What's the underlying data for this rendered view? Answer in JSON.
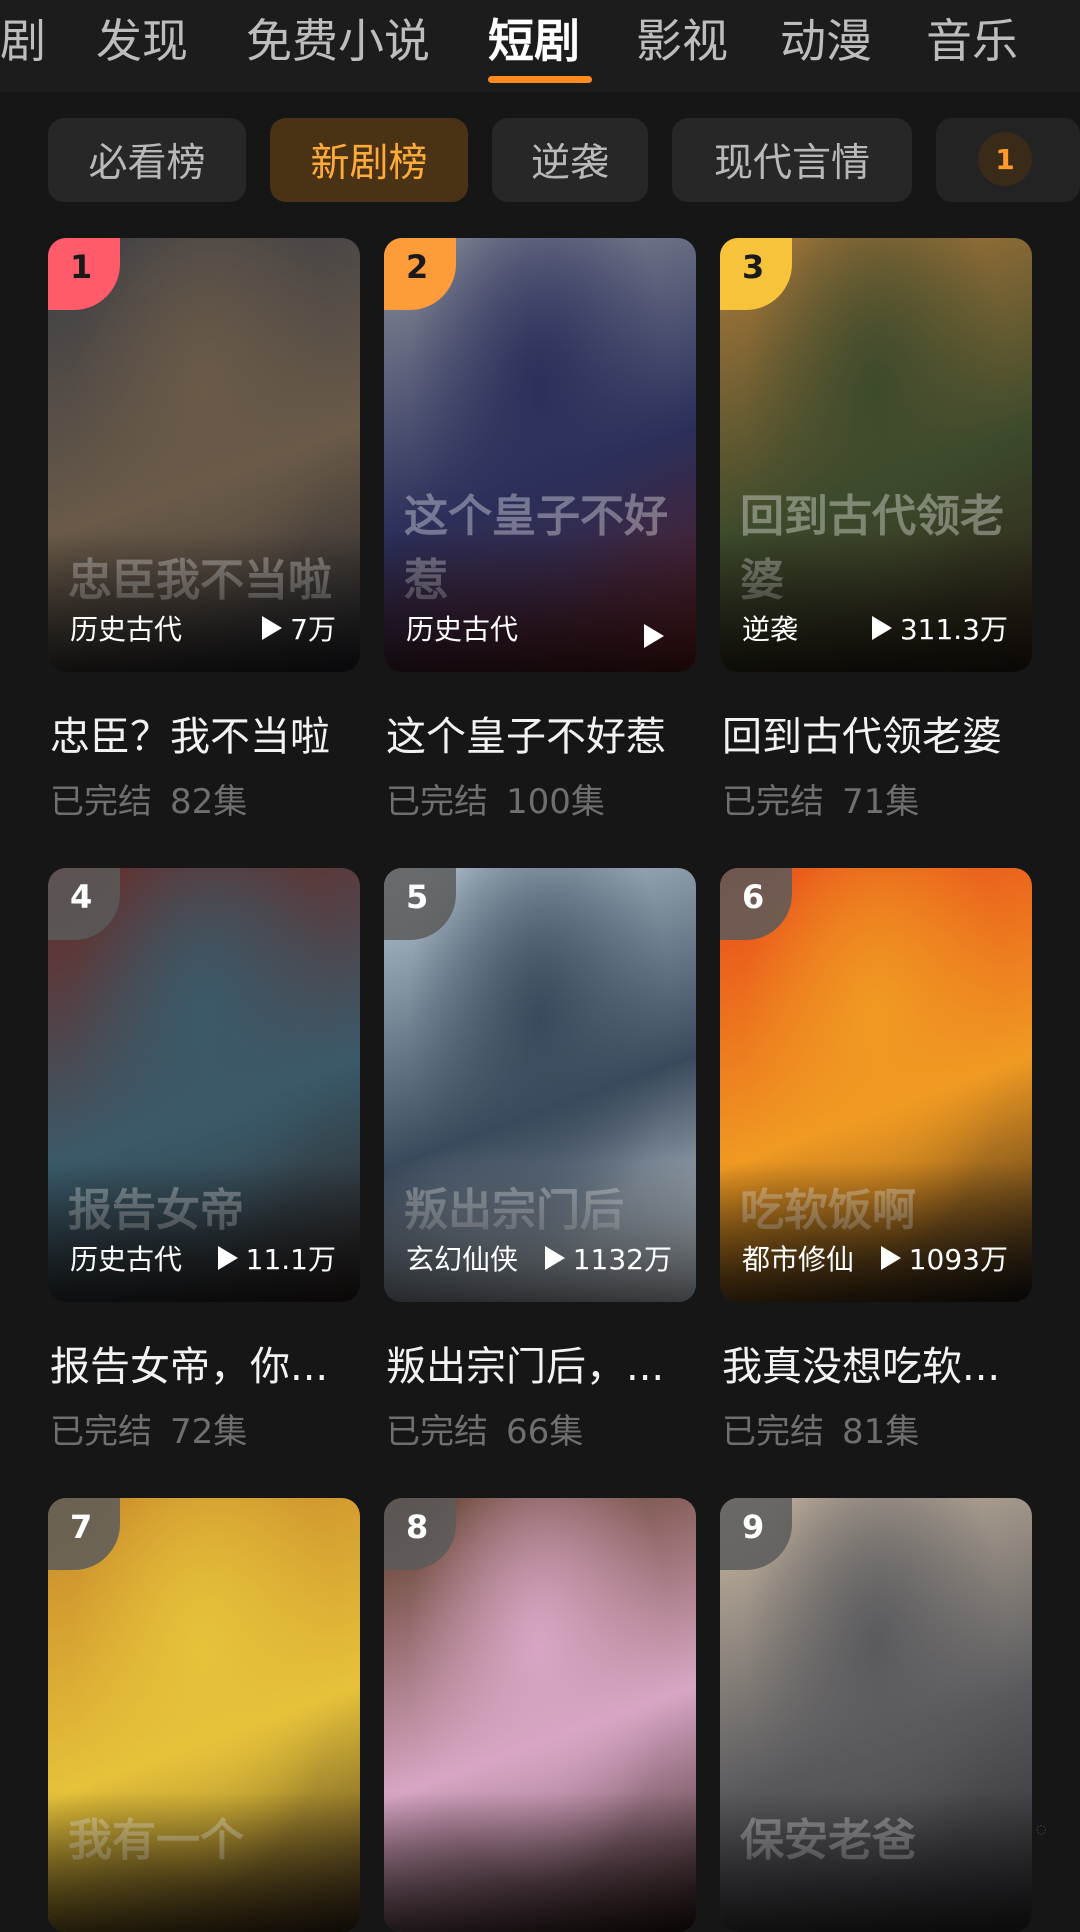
{
  "top_nav": {
    "tabs": [
      {
        "label": "剧",
        "active": false
      },
      {
        "label": "发现",
        "active": false
      },
      {
        "label": "免费小说",
        "active": false
      },
      {
        "label": "短剧",
        "active": true
      },
      {
        "label": "影视",
        "active": false
      },
      {
        "label": "动漫",
        "active": false
      },
      {
        "label": "音乐",
        "active": false
      }
    ],
    "accent_color": "#ff8a1e"
  },
  "chips": {
    "items": [
      {
        "label": "必看榜",
        "active": false
      },
      {
        "label": "新剧榜",
        "active": true
      },
      {
        "label": "逆袭",
        "active": false
      },
      {
        "label": "现代言情",
        "active": false
      }
    ],
    "badge_count": "1"
  },
  "dramas": [
    {
      "rank": "1",
      "genre": "历史古代",
      "plays": "7万",
      "title": "忠臣？我不当啦",
      "status": "已完结",
      "episodes": "82集",
      "art_text": "忠臣我不当啦",
      "colors": [
        "#3b3d45",
        "#6a5a48",
        "#20222a"
      ]
    },
    {
      "rank": "2",
      "genre": "历史古代",
      "plays": "",
      "title": "这个皇子不好惹",
      "status": "已完结",
      "episodes": "100集",
      "art_text": "这个皇子不好惹",
      "colors": [
        "#8a8f9a",
        "#2b2f5a",
        "#5a1a1a"
      ]
    },
    {
      "rank": "3",
      "genre": "逆袭",
      "plays": "311.3万",
      "title": "回到古代领老婆",
      "status": "已完结",
      "episodes": "71集",
      "art_text": "回到古代领老婆",
      "colors": [
        "#b07a3a",
        "#3d4a2c",
        "#2a1c14"
      ]
    },
    {
      "rank": "4",
      "genre": "历史古代",
      "plays": "11.1万",
      "title": "报告女帝，你...",
      "status": "已完结",
      "episodes": "72集",
      "art_text": "报告女帝",
      "colors": [
        "#6a2a24",
        "#3a5a6a",
        "#2a1f1c"
      ]
    },
    {
      "rank": "5",
      "genre": "玄幻仙侠",
      "plays": "1132万",
      "title": "叛出宗门后，...",
      "status": "已完结",
      "episodes": "66集",
      "art_text": "叛出宗门后",
      "colors": [
        "#b8c8d4",
        "#3a4a5c",
        "#e0e8ee"
      ]
    },
    {
      "rank": "6",
      "genre": "都市修仙",
      "plays": "1093万",
      "title": "我真没想吃软...",
      "status": "已完结",
      "episodes": "81集",
      "art_text": "吃软饭啊",
      "colors": [
        "#e8481a",
        "#f09a22",
        "#1d1a18"
      ]
    },
    {
      "rank": "7",
      "genre": "",
      "plays": "",
      "title": "",
      "status": "",
      "episodes": "",
      "art_text": "我有一个",
      "colors": [
        "#c8872a",
        "#e6c23a",
        "#3a2a1a"
      ]
    },
    {
      "rank": "8",
      "genre": "",
      "plays": "",
      "title": "",
      "status": "",
      "episodes": "",
      "art_text": "",
      "colors": [
        "#5a3a22",
        "#d8a6c4",
        "#2a1a16"
      ]
    },
    {
      "rank": "9",
      "genre": "",
      "plays": "",
      "title": "",
      "status": "",
      "episodes": "",
      "art_text": "保安老爸",
      "colors": [
        "#c9b8a2",
        "#5a5a5e",
        "#2a2a2e"
      ]
    }
  ]
}
